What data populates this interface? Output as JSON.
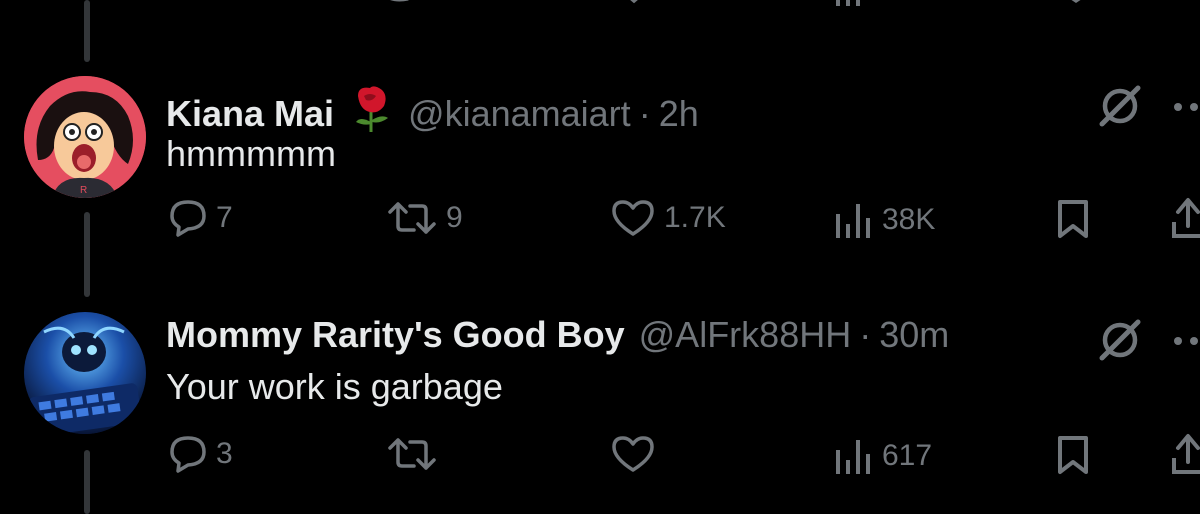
{
  "posts": [
    {
      "name": "Kiana Mai",
      "emoji": "🌹",
      "handle": "@kianamaiart",
      "separator": "·",
      "time": "2h",
      "text": "hmmmmm",
      "replies": "7",
      "reposts": "9",
      "likes": "1.7K",
      "views": "38K"
    },
    {
      "name": "Mommy Rarity's Good Boy",
      "handle": "@AlFrk88HH",
      "separator": "·",
      "time": "30m",
      "text": "Your work is garbage",
      "replies": "3",
      "reposts": "",
      "likes": "",
      "views": "617"
    }
  ],
  "colors": {
    "background": "#000000",
    "primary_text": "#e7e9ea",
    "secondary_text": "#71767b",
    "thread_line": "#333639"
  }
}
